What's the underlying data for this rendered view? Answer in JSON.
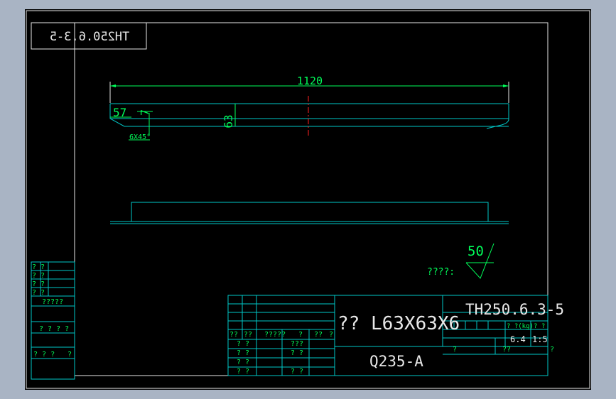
{
  "drawing": {
    "mirrored_code": "TH250.6.3-5",
    "length_dim": "1120",
    "left_dim": "57",
    "small_dim": "7",
    "height_dim": "63",
    "chamfer": "6X45°",
    "roughness_value": "50",
    "roughness_label": "????:"
  },
  "title_block": {
    "title": "?? L63X63X6",
    "drawing_no": "TH250.6.3-5",
    "material": "Q235-A",
    "weight": "6.4",
    "scale": "1:5",
    "row_labels": [
      "?? ",
      "?? ",
      "?? ",
      "?? ",
      "?? "
    ],
    "head_labels": [
      "??",
      "??",
      "?????",
      "?",
      "??",
      "?"
    ],
    "cells": [
      "? ?",
      "? ?",
      "? ?",
      "? ?",
      "???",
      "? ?",
      "? ?"
    ],
    "weight_label": "? ?(kg)",
    "scale_label": "?  ?",
    "left_cells": [
      "?????",
      "? ? ? ?",
      "? ? ?",
      "?"
    ],
    "bottom_cells": [
      "?",
      "??",
      "?"
    ]
  }
}
